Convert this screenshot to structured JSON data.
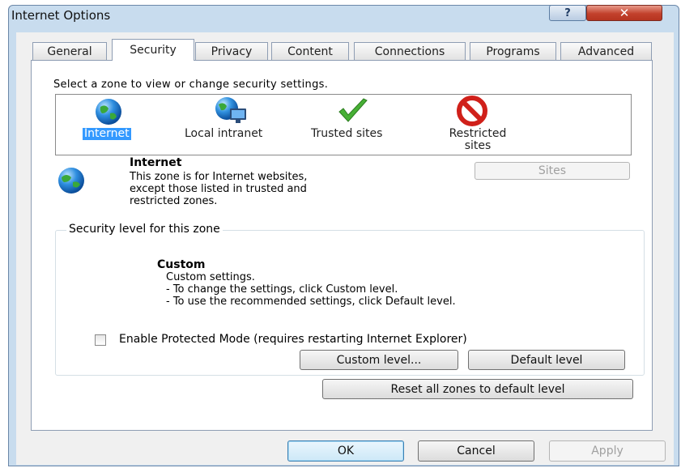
{
  "window": {
    "title": "Internet Options",
    "help_label": "?",
    "close_label": "✕"
  },
  "tabs": [
    {
      "label": "General"
    },
    {
      "label": "Security",
      "active": true
    },
    {
      "label": "Privacy"
    },
    {
      "label": "Content"
    },
    {
      "label": "Connections"
    },
    {
      "label": "Programs"
    },
    {
      "label": "Advanced"
    }
  ],
  "security": {
    "zone_prompt": "Select a zone to view or change security settings.",
    "zones": [
      {
        "label": "Internet",
        "icon": "globe-icon",
        "selected": true
      },
      {
        "label": "Local intranet",
        "icon": "intranet-icon"
      },
      {
        "label": "Trusted sites",
        "icon": "checkmark-icon"
      },
      {
        "label": "Restricted sites",
        "icon": "restricted-icon"
      }
    ],
    "zone_info": {
      "title": "Internet",
      "description": "This zone is for Internet websites,\nexcept those listed in trusted and\nrestricted zones.",
      "icon": "globe-icon"
    },
    "sites_button": "Sites",
    "level_group": {
      "legend": "Security level for this zone",
      "level_title": "Custom",
      "level_desc": "Custom settings.\n- To change the settings, click Custom level.\n- To use the recommended settings, click Default level."
    },
    "protected_mode": {
      "label": "Enable Protected Mode (requires restarting Internet Explorer)",
      "checked": false
    },
    "custom_level_button": "Custom level...",
    "default_level_button": "Default level",
    "reset_button": "Reset all zones to default level"
  },
  "footer": {
    "ok": "OK",
    "cancel": "Cancel",
    "apply": "Apply"
  },
  "colors": {
    "selection": "#3399ff",
    "title_bar": "#c8dcee",
    "close_red": "#c2412c"
  }
}
